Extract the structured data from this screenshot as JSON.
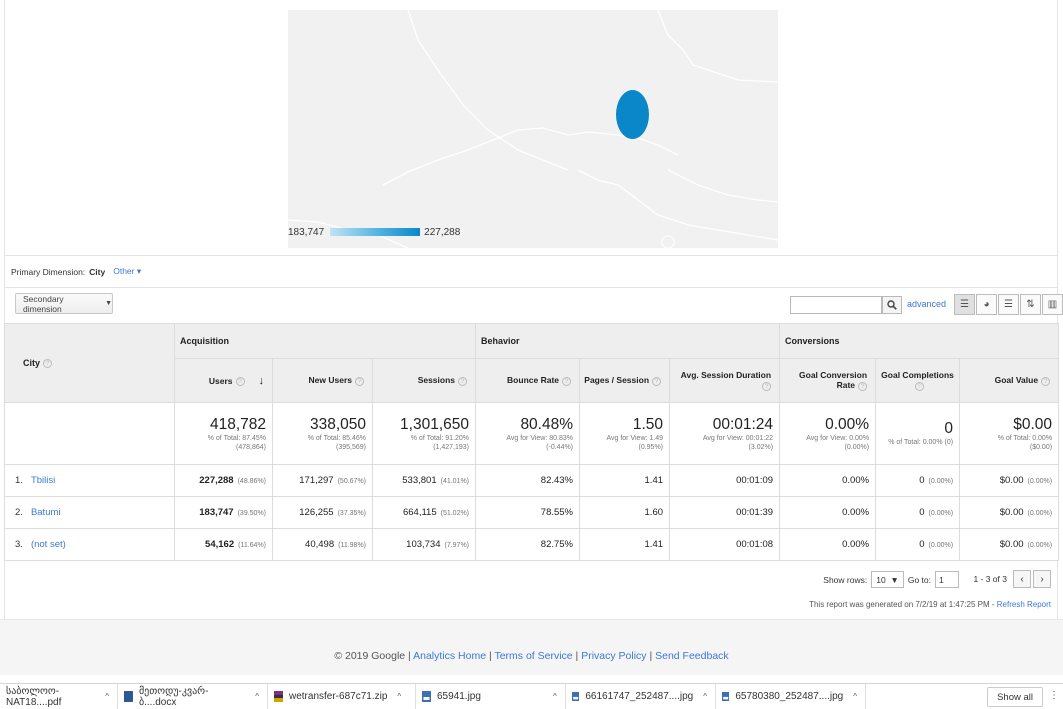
{
  "map": {
    "legend_min": "183,747",
    "legend_max": "227,288",
    "bubble_color": "#0a87c8"
  },
  "primary_dimension": {
    "label": "Primary Dimension:",
    "value": "City",
    "other": "Other"
  },
  "toolbar": {
    "secondary_dimension": "Secondary dimension",
    "advanced": "advanced"
  },
  "table": {
    "groups": {
      "acquisition": "Acquisition",
      "behavior": "Behavior",
      "conversions": "Conversions"
    },
    "columns": {
      "city": "City",
      "users": "Users",
      "new_users": "New Users",
      "sessions": "Sessions",
      "bounce_rate": "Bounce Rate",
      "pages_session": "Pages / Session",
      "avg_session_duration": "Avg. Session Duration",
      "goal_conversion_rate": "Goal Conversion Rate",
      "goal_completions": "Goal Completions",
      "goal_value": "Goal Value"
    },
    "totals": {
      "users": {
        "value": "418,782",
        "sub1": "% of Total: 87.45%",
        "sub2": "(478,864)"
      },
      "new_users": {
        "value": "338,050",
        "sub1": "% of Total: 85.46%",
        "sub2": "(395,569)"
      },
      "sessions": {
        "value": "1,301,650",
        "sub1": "% of Total: 91.20%",
        "sub2": "(1,427,193)"
      },
      "bounce_rate": {
        "value": "80.48%",
        "sub1": "Avg for View: 80.83%",
        "sub2": "(-0.44%)"
      },
      "pages_session": {
        "value": "1.50",
        "sub1": "Avg for View: 1.49",
        "sub2": "(0.95%)"
      },
      "avg_session_duration": {
        "value": "00:01:24",
        "sub1": "Avg for View: 00:01:22",
        "sub2": "(3.02%)"
      },
      "goal_conversion_rate": {
        "value": "0.00%",
        "sub1": "Avg for View: 0.00%",
        "sub2": "(0.00%)"
      },
      "goal_completions": {
        "value": "0",
        "sub1": "% of Total: 0.00% (0)",
        "sub2": ""
      },
      "goal_value": {
        "value": "$0.00",
        "sub1": "% of Total: 0.00%",
        "sub2": "($0.00)"
      }
    },
    "rows": [
      {
        "idx": "1.",
        "city": "Tbilisi",
        "users": "227,288",
        "users_pct": "(48.86%)",
        "new_users": "171,297",
        "new_users_pct": "(50.67%)",
        "sessions": "533,801",
        "sessions_pct": "(41.01%)",
        "bounce_rate": "82.43%",
        "pages_session": "1.41",
        "avg_session_duration": "00:01:09",
        "goal_conversion_rate": "0.00%",
        "goal_completions": "0",
        "goal_completions_pct": "(0.00%)",
        "goal_value": "$0.00",
        "goal_value_pct": "(0.00%)"
      },
      {
        "idx": "2.",
        "city": "Batumi",
        "users": "183,747",
        "users_pct": "(39.50%)",
        "new_users": "126,255",
        "new_users_pct": "(37.35%)",
        "sessions": "664,115",
        "sessions_pct": "(51.02%)",
        "bounce_rate": "78.55%",
        "pages_session": "1.60",
        "avg_session_duration": "00:01:39",
        "goal_conversion_rate": "0.00%",
        "goal_completions": "0",
        "goal_completions_pct": "(0.00%)",
        "goal_value": "$0.00",
        "goal_value_pct": "(0.00%)"
      },
      {
        "idx": "3.",
        "city": "(not set)",
        "users": "54,162",
        "users_pct": "(11.64%)",
        "new_users": "40,498",
        "new_users_pct": "(11.98%)",
        "sessions": "103,734",
        "sessions_pct": "(7.97%)",
        "bounce_rate": "82.75%",
        "pages_session": "1.41",
        "avg_session_duration": "00:01:08",
        "goal_conversion_rate": "0.00%",
        "goal_completions": "0",
        "goal_completions_pct": "(0.00%)",
        "goal_value": "$0.00",
        "goal_value_pct": "(0.00%)"
      }
    ]
  },
  "pagination": {
    "show_rows_label": "Show rows:",
    "show_rows_value": "10",
    "goto_label": "Go to:",
    "goto_value": "1",
    "range": "1 - 3 of 3"
  },
  "report_note": {
    "text": "This report was generated on 7/2/19 at 1:47:25 PM - ",
    "link": "Refresh Report"
  },
  "footer": {
    "copyright": "© 2019 Google | ",
    "links": [
      "Analytics Home",
      "Terms of Service",
      "Privacy Policy",
      "Send Feedback"
    ]
  },
  "downloads": {
    "items": [
      {
        "name": "საბოლოო-NAT18....pdf",
        "icon": "pdf-file-icon"
      },
      {
        "name": "მეთოდუ-კვარ-ბ....docx",
        "icon": "word-file-icon"
      },
      {
        "name": "wetransfer-687c71.zip",
        "icon": "zip-file-icon"
      },
      {
        "name": "65941.jpg",
        "icon": "image-file-icon"
      },
      {
        "name": "66161747_252487....jpg",
        "icon": "image-file-icon"
      },
      {
        "name": "65780380_252487....jpg",
        "icon": "image-file-icon"
      }
    ],
    "show_all": "Show all"
  }
}
